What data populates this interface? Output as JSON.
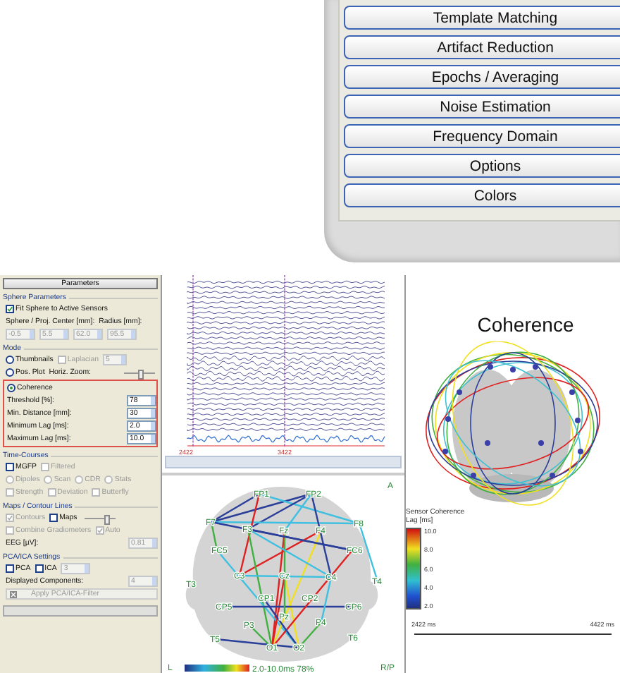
{
  "menu_buttons": [
    "Template Matching",
    "Artifact Reduction",
    "Epochs / Averaging",
    "Noise Estimation",
    "Frequency Domain",
    "Options",
    "Colors"
  ],
  "parameters": {
    "title": "Parameters",
    "groups": [
      {
        "title": "Sphere Parameters",
        "rows": [
          {
            "items": [
              {
                "kind": "checkbox",
                "label": "Fit Sphere to Active Sensors",
                "checked": true,
                "disabled": false
              }
            ]
          },
          {
            "items": [
              {
                "kind": "label",
                "text": "Sphere / Proj. Center [mm]:"
              },
              {
                "kind": "label",
                "text": "Radius [mm]:"
              }
            ]
          },
          {
            "items": [
              {
                "kind": "spin",
                "value": "-0.5",
                "disabled": true
              },
              {
                "kind": "spin",
                "value": "5.5",
                "disabled": true
              },
              {
                "kind": "spin",
                "value": "62.0",
                "disabled": true
              },
              {
                "kind": "spin",
                "value": "95.5",
                "disabled": true
              }
            ]
          }
        ]
      },
      {
        "title": "Mode",
        "rows": [
          {
            "items": [
              {
                "kind": "radio",
                "label": "Thumbnails",
                "selected": false,
                "disabled": false
              },
              {
                "kind": "checkbox",
                "label": "Laplacian",
                "checked": false,
                "disabled": true
              },
              {
                "kind": "dropdown",
                "value": "5",
                "disabled": true
              }
            ]
          },
          {
            "items": [
              {
                "kind": "radio",
                "label": "Pos. Plot",
                "selected": false,
                "disabled": false
              },
              {
                "kind": "label",
                "text": "Horiz. Zoom:"
              },
              {
                "kind": "slider",
                "level": 0.5
              }
            ]
          },
          {
            "highlighted": true,
            "rows": [
              {
                "items": [
                  {
                    "kind": "radio",
                    "label": "Coherence",
                    "selected": true,
                    "disabled": false
                  }
                ]
              },
              {
                "items": [
                  {
                    "kind": "label",
                    "text": "Threshold [%]:"
                  },
                  {
                    "kind": "spin",
                    "value": "78",
                    "disabled": false
                  }
                ]
              },
              {
                "items": [
                  {
                    "kind": "label",
                    "text": "Min. Distance [mm]:"
                  },
                  {
                    "kind": "spin",
                    "value": "30",
                    "disabled": false
                  }
                ]
              },
              {
                "items": [
                  {
                    "kind": "label",
                    "text": "Minimum Lag [ms]:"
                  },
                  {
                    "kind": "spin",
                    "value": "2.0",
                    "disabled": false
                  }
                ]
              },
              {
                "items": [
                  {
                    "kind": "label",
                    "text": "Maximum Lag [ms]:"
                  },
                  {
                    "kind": "spin",
                    "value": "10.0",
                    "disabled": false
                  }
                ]
              }
            ]
          }
        ]
      },
      {
        "title": "Time-Courses",
        "rows": [
          {
            "items": [
              {
                "kind": "checkbox",
                "label": "MGFP",
                "checked": false,
                "disabled": false
              },
              {
                "kind": "checkbox",
                "label": "Filtered",
                "checked": false,
                "disabled": true
              }
            ]
          },
          {
            "items": [
              {
                "kind": "radio",
                "label": "Dipoles",
                "selected": false,
                "disabled": true
              },
              {
                "kind": "radio",
                "label": "Scan",
                "selected": false,
                "disabled": true
              },
              {
                "kind": "radio",
                "label": "CDR",
                "selected": false,
                "disabled": true
              },
              {
                "kind": "radio",
                "label": "Stats",
                "selected": false,
                "disabled": true
              }
            ]
          },
          {
            "items": [
              {
                "kind": "checkbox",
                "label": "Strength",
                "checked": false,
                "disabled": true
              },
              {
                "kind": "checkbox",
                "label": "Deviation",
                "checked": false,
                "disabled": true
              },
              {
                "kind": "checkbox",
                "label": "Butterfly",
                "checked": false,
                "disabled": true
              }
            ]
          }
        ]
      },
      {
        "title": "Maps / Contour Lines",
        "rows": [
          {
            "items": [
              {
                "kind": "checkbox",
                "label": "Contours",
                "checked": true,
                "disabled": true
              },
              {
                "kind": "checkbox",
                "label": "Maps",
                "checked": false,
                "disabled": false
              },
              {
                "kind": "slider",
                "level": 0.7
              }
            ]
          },
          {
            "items": [
              {
                "kind": "checkbox",
                "label": "Combine Gradiometers",
                "checked": false,
                "disabled": true
              },
              {
                "kind": "checkbox",
                "label": "Auto",
                "checked": true,
                "disabled": true
              }
            ]
          },
          {
            "items": [
              {
                "kind": "label",
                "text": "EEG [µV]:"
              },
              {
                "kind": "spin",
                "value": "0.81",
                "disabled": true
              }
            ]
          }
        ]
      },
      {
        "title": "PCA/ICA Settings",
        "rows": [
          {
            "items": [
              {
                "kind": "checkbox",
                "label": "PCA",
                "checked": false,
                "disabled": false
              },
              {
                "kind": "checkbox",
                "label": "ICA",
                "checked": false,
                "disabled": false
              },
              {
                "kind": "spin",
                "value": "3",
                "disabled": true
              }
            ]
          },
          {
            "items": [
              {
                "kind": "label",
                "text": "Displayed Components:"
              },
              {
                "kind": "spin",
                "value": "4",
                "disabled": true
              }
            ]
          },
          {
            "items": [
              {
                "kind": "button",
                "label": "Apply PCA/ICA-Filter",
                "disabled": true
              }
            ]
          }
        ]
      }
    ]
  },
  "eeg_view": {
    "time_labels": [
      "2422",
      "3422"
    ]
  },
  "topo_map": {
    "corner_labels": [
      "A",
      "L",
      "R/P"
    ],
    "electrodes": [
      "FP1",
      "FP2",
      "F7",
      "F3",
      "Fz",
      "F4",
      "F8",
      "FC5",
      "FC6",
      "C3",
      "Cz",
      "C4",
      "T3",
      "T4",
      "CP1",
      "CP2",
      "CP5",
      "CP6",
      "P3",
      "Pz",
      "P4",
      "T5",
      "T6",
      "O1",
      "O2"
    ],
    "legend_text": "2.0-10.0ms 78%"
  },
  "coherence_view": {
    "title": "Coherence",
    "legend_title": "Sensor Coherence",
    "legend_unit": "Lag [ms]",
    "legend_ticks": [
      "10.0",
      "8.0",
      "6.0",
      "4.0",
      "2.0"
    ],
    "time_start": "2422 ms",
    "time_end": "4422 ms"
  }
}
